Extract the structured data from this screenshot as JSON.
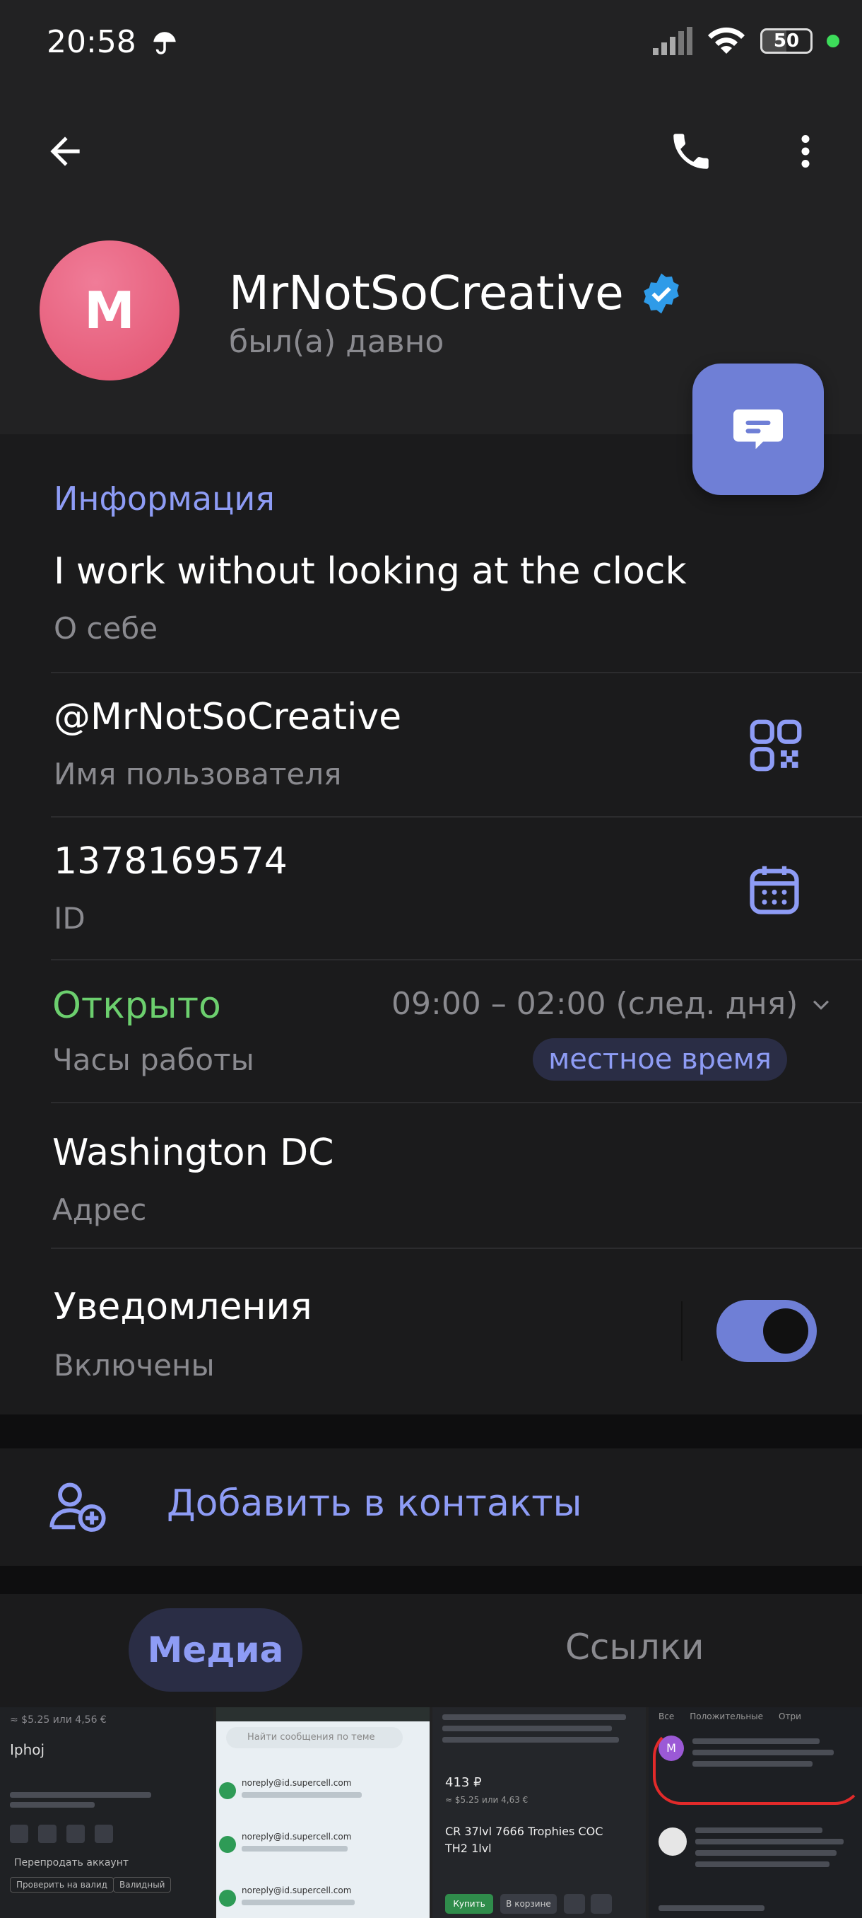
{
  "status_bar": {
    "time": "20:58",
    "battery": "50",
    "icons": [
      "umbrella-icon",
      "signal-icon",
      "wifi-icon",
      "battery-icon",
      "active-dot"
    ]
  },
  "header": {
    "back_icon": "arrow-left-icon",
    "call_icon": "phone-icon",
    "menu_icon": "more-vertical-icon"
  },
  "profile": {
    "avatar_letter": "M",
    "name": "MrNotSoCreative",
    "status": "был(а) давно",
    "verified": true
  },
  "info": {
    "section_title": "Информация",
    "bio": {
      "value": "I work without looking at the clock",
      "label": "О себе"
    },
    "username": {
      "value": "@MrNotSoCreative",
      "label": "Имя пользователя"
    },
    "id": {
      "value": "1378169574",
      "label": "ID"
    },
    "hours": {
      "state": "Открыто",
      "label": "Часы работы",
      "range": "09:00 – 02:00 (след. дня)",
      "local_time": "местное время"
    },
    "address": {
      "value": "Washington DC",
      "label": "Адрес"
    },
    "notifications": {
      "value": "Уведомления",
      "label": "Включены",
      "enabled": true
    }
  },
  "actions": {
    "add_contact": "Добавить в контакты"
  },
  "tabs": {
    "media": "Медиа",
    "links": "Ссылки"
  },
  "media_thumbnails": {
    "t1": {
      "title": "Iphoj",
      "line1": "≈ $5.25 или 4,56 €",
      "line2": "Перепродать аккаунт",
      "line3": "Проверить на валид",
      "line4": "Валидный"
    },
    "t2": {
      "search": "Найти сообщения по теме",
      "from1": "noreply@id.supercell.com",
      "from2": "noreply@id.supercell.com",
      "from3": "noreply@id.supercell.com"
    },
    "t3": {
      "price": "413 ₽",
      "sub": "≈ $5.25 или 4,63 €",
      "title": "CR 37lvl 7666 Trophies COC TH2 1lvl",
      "buy": "Купить",
      "cart": "В корзине"
    },
    "t4": {
      "avatar": "M",
      "tab1": "Все",
      "tab2": "Положительные",
      "tab3": "Отри"
    }
  },
  "colors": {
    "accent": "#8e9cf5",
    "open_green": "#6ccf6e",
    "fab": "#6f7fd6",
    "avatar": "#e2526f",
    "verified": "#2f9be8"
  }
}
